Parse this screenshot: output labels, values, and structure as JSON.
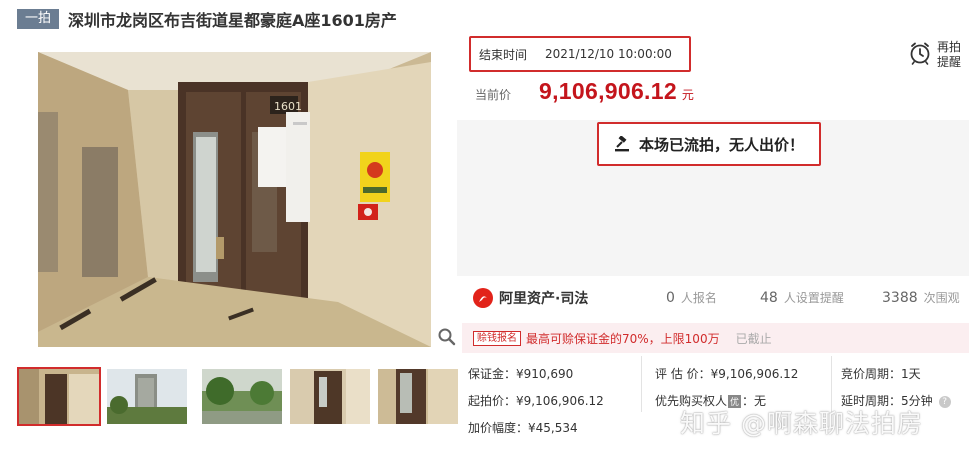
{
  "title": {
    "badge": "一拍",
    "text": "深圳市龙岗区布吉街道星都豪庭A座1601房产"
  },
  "auction": {
    "end_label": "结束时间",
    "end_time": "2021/12/10 10:00:00",
    "remind_line1": "再拍",
    "remind_line2": "提醒",
    "price_label": "当前价",
    "price": "9,106,906.12",
    "price_unit": "元",
    "status": "本场已流拍，无人出价！"
  },
  "brand": {
    "name": "阿里资产·司法"
  },
  "stats": [
    {
      "num": "0",
      "label": "人报名"
    },
    {
      "num": "48",
      "label": "人设置提醒"
    },
    {
      "num": "3388",
      "label": "次围观"
    }
  ],
  "loan_bar": {
    "tag": "赊钱报名",
    "text": "最高可赊保证金的70%，上限100万",
    "end": "已截止"
  },
  "details": {
    "deposit": "保证金：¥910,690",
    "start_price": "起拍价：¥9,106,906.12",
    "increment": "加价幅度：¥45,534",
    "appraisal": "评 估 价：¥9,106,906.12",
    "priority_pre": "优先购买权人",
    "priority_tag": "优",
    "priority_post": "：无",
    "bid_cycle": "竞价周期：1天",
    "delay_cycle": "延时周期：5分钟"
  },
  "watermark": "知乎 @啊森聊法拍房",
  "colors": {
    "accent_red": "#d12c2c",
    "price_red": "#c4151c",
    "badge_gray": "#6b7d92"
  },
  "icons": [
    "zoom-icon",
    "alarm-clock-icon",
    "gavel-icon",
    "alibaba-logo-icon",
    "help-icon"
  ]
}
